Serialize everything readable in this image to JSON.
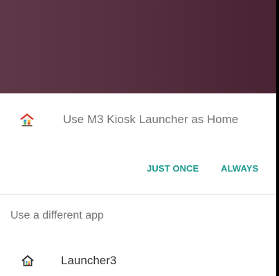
{
  "dialog": {
    "primary_app": {
      "label": "Use M3 Kiosk Launcher as Home",
      "icon": "kiosk-home-icon"
    },
    "actions": {
      "just_once": "JUST ONCE",
      "always": "ALWAYS"
    },
    "other_section_label": "Use a different app",
    "other_apps": [
      {
        "label": "Launcher3",
        "icon": "house-icon"
      }
    ]
  },
  "colors": {
    "accent": "#1a9a8c",
    "wallpaper": "#56303f",
    "text_secondary": "#747474"
  }
}
